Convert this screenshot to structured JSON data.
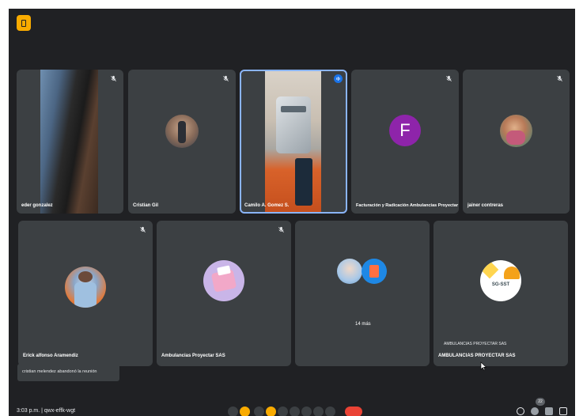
{
  "colors": {
    "background": "#202124",
    "tile": "#3c4043",
    "active_outline": "#8ab4f8",
    "accent_yellow": "#f9ab00",
    "end_call_red": "#ea4335",
    "avatar_purple": "#8e24aa"
  },
  "top_bar": {
    "icon": "meeting-app-icon"
  },
  "participants_row1": [
    {
      "name": "eder gonzalez",
      "mic_muted": true
    },
    {
      "name": "Cristian Gil",
      "mic_muted": true
    },
    {
      "name": "Camilo A. Gomez S.",
      "speaking": true
    },
    {
      "name": "Facturación y Radicación Ambulancias Proyectar",
      "mic_muted": true,
      "avatar_letter": "F"
    },
    {
      "name": "jainer contreras",
      "mic_muted": true
    }
  ],
  "participants_row2": [
    {
      "name": "Erick alfonso Aramendiz",
      "mic_muted": true
    },
    {
      "name": "Ambulancias Proyectar SAS",
      "mic_muted": true
    },
    {
      "name": "",
      "more_label": "14 más"
    },
    {
      "name": "AMBULANCIAS PROYECTAR SAS",
      "avatar_text": "SG-SST"
    }
  ],
  "toast": {
    "text": "cristian melendez abandonó la reunión"
  },
  "tooltip": {
    "text": "AMBULANCIAS PROYECTAR SAS"
  },
  "bottom_bar": {
    "time_text": "3:03 p.m. | qwx-effk-wgt",
    "participant_count": "22"
  }
}
